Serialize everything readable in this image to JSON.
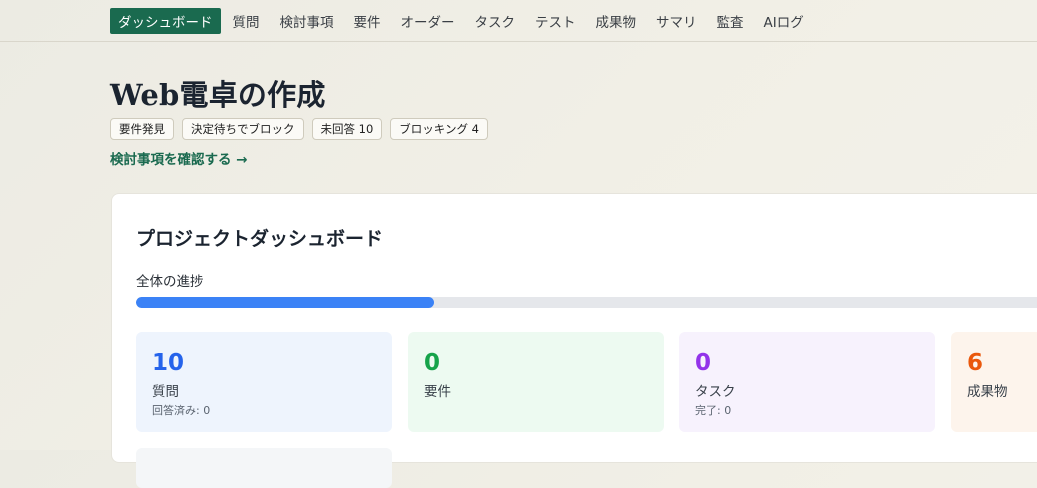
{
  "nav": {
    "items": [
      {
        "label": "ダッシュボード",
        "active": true
      },
      {
        "label": "質問"
      },
      {
        "label": "検討事項"
      },
      {
        "label": "要件"
      },
      {
        "label": "オーダー"
      },
      {
        "label": "タスク"
      },
      {
        "label": "テスト"
      },
      {
        "label": "成果物"
      },
      {
        "label": "サマリ"
      },
      {
        "label": "監査"
      },
      {
        "label": "AIログ"
      }
    ]
  },
  "project": {
    "title": "Web電卓の作成",
    "badges": [
      "要件発見",
      "決定待ちでブロック",
      "未回答 10",
      "ブロッキング 4"
    ],
    "review_link": "検討事項を確認する →"
  },
  "dashboard": {
    "title": "プロジェクトダッシュボード",
    "progress_label": "全体の進捗",
    "progress_fraction": 0.32,
    "progress_color": "#3b82f6",
    "stats": [
      {
        "value": "10",
        "label": "質問",
        "sub": "回答済み: 0",
        "color": "#2563eb",
        "bg": "#eef4fd"
      },
      {
        "value": "0",
        "label": "要件",
        "sub": "",
        "color": "#16a34a",
        "bg": "#edfaf1"
      },
      {
        "value": "0",
        "label": "タスク",
        "sub": "完了: 0",
        "color": "#9333ea",
        "bg": "#f7f2fd"
      },
      {
        "value": "6",
        "label": "成果物",
        "sub": "",
        "color": "#ea580c",
        "bg": "#fdf4ec"
      }
    ]
  },
  "colors": {
    "accent": "#1a6a4f",
    "background": "#efede5"
  }
}
